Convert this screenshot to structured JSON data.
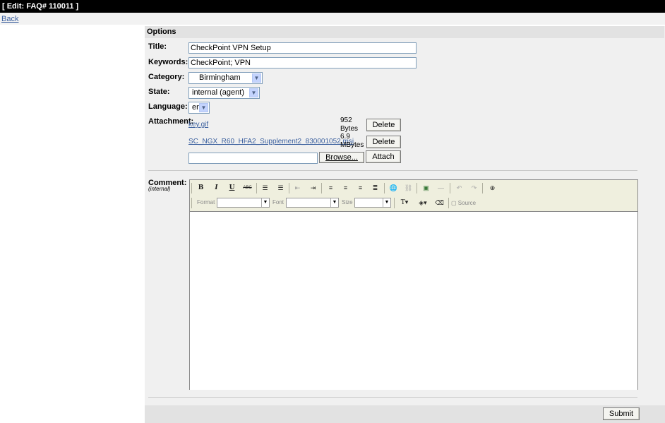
{
  "header": {
    "title": "[ Edit: FAQ# 110011 ]",
    "back_label": "Back"
  },
  "form": {
    "section_title": "Options",
    "title_label": "Title:",
    "title_value": "CheckPoint VPN Setup",
    "keywords_label": "Keywords:",
    "keywords_value": "CheckPoint; VPN",
    "category_label": "Category:",
    "category_value": "Birmingham",
    "state_label": "State:",
    "state_value": "internal (agent)",
    "language_label": "Language:",
    "language_value": "en",
    "attachment_label": "Attachment:",
    "attachments": [
      {
        "name": "key.gif",
        "size_line1": "952",
        "size_line2": "Bytes",
        "delete_label": "Delete"
      },
      {
        "name": "SC_NGX_R60_HFA2_Supplement2_830001052.msi",
        "size_line1": "6.9",
        "size_line2": "MBytes",
        "delete_label": "Delete"
      }
    ],
    "file_input_value": "",
    "browse_label": "Browse...",
    "attach_label": "Attach",
    "comment_label": "Comment:",
    "comment_sublabel": "(internal)",
    "submit_label": "Submit"
  },
  "toolbar": {
    "bold": "B",
    "italic": "I",
    "underline": "U",
    "strike": "ABC",
    "format_label": "Format",
    "font_label": "Font",
    "size_label": "Size",
    "text_color": "T",
    "source_label": "Source"
  }
}
